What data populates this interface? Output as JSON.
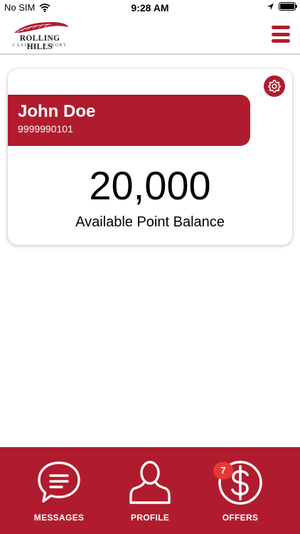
{
  "status_bar": {
    "carrier": "No SIM",
    "time": "9:28 AM",
    "battery_level": 1.0
  },
  "header": {
    "logo_name": "ROLLING HILLS",
    "logo_subtitle": "CASINO · RESORT",
    "menu_icon": "hamburger-menu-icon"
  },
  "card": {
    "member_name": "John Doe",
    "member_number": "9999990101",
    "points": "20,000",
    "points_label": "Available Point Balance",
    "settings_icon": "gear-icon"
  },
  "nav": {
    "messages_label": "MESSAGES",
    "profile_label": "PROFILE",
    "offers_label": "OFFERS",
    "offers_badge": "7"
  },
  "colors": {
    "brand_red": "#b01c2e",
    "badge_red": "#e53935"
  }
}
